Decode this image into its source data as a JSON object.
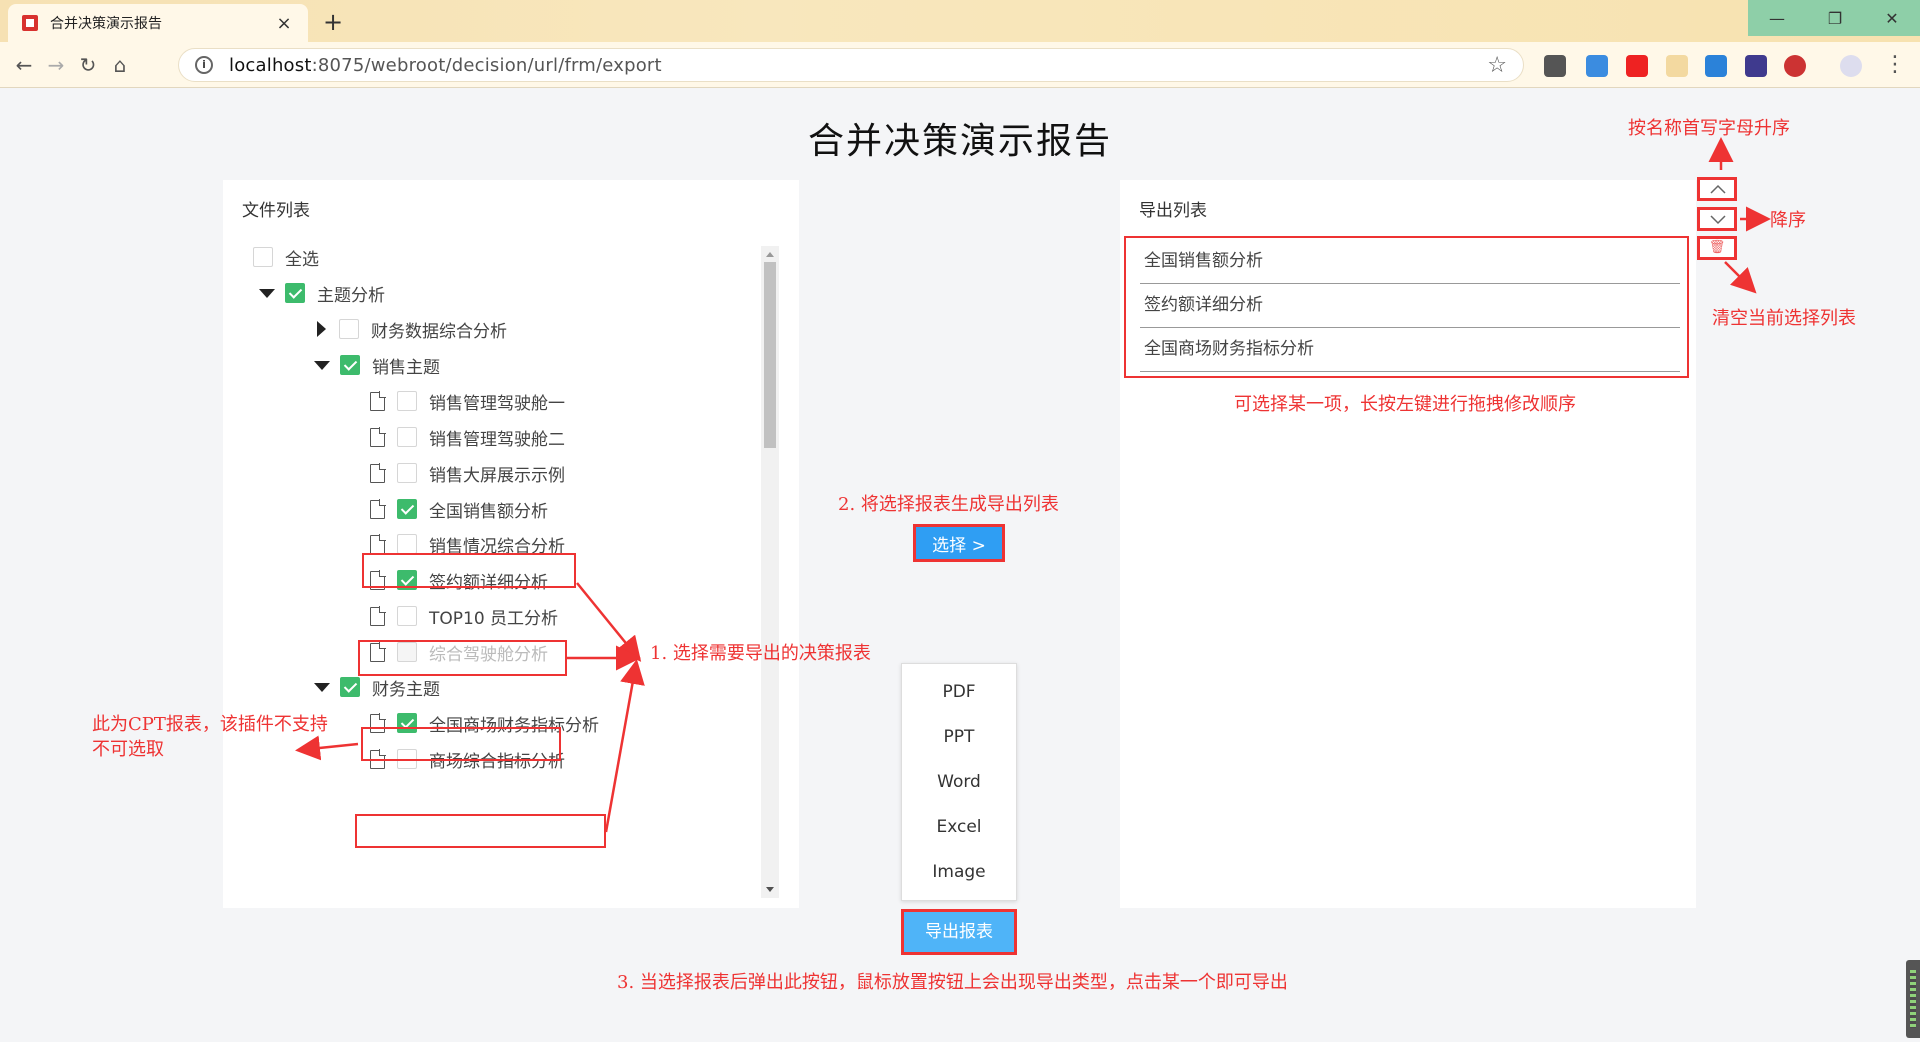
{
  "browser": {
    "tab_title": "合并决策演示报告",
    "tab_close": "×",
    "new_tab": "+",
    "url_host": "localhost",
    "url_rest": ":8075/webroot/decision/url/frm/export",
    "window_controls": {
      "minimize": "—",
      "maximize": "❐",
      "close": "✕"
    }
  },
  "page": {
    "title": "合并决策演示报告"
  },
  "file_panel": {
    "header": "文件列表",
    "select_all": "全选",
    "items": [
      {
        "label": "主题分析",
        "checked": true
      },
      {
        "label": "财务数据综合分析",
        "checked": false
      },
      {
        "label": "销售主题",
        "checked": true
      },
      {
        "label": "销售管理驾驶舱一",
        "checked": false
      },
      {
        "label": "销售管理驾驶舱二",
        "checked": false
      },
      {
        "label": "销售大屏展示示例",
        "checked": false
      },
      {
        "label": "全国销售额分析",
        "checked": true
      },
      {
        "label": "销售情况综合分析",
        "checked": false
      },
      {
        "label": "签约额详细分析",
        "checked": true
      },
      {
        "label": "TOP10 员工分析",
        "checked": false
      },
      {
        "label": "综合驾驶舱分析",
        "checked": false,
        "disabled": true
      },
      {
        "label": "财务主题",
        "checked": true
      },
      {
        "label": "全国商场财务指标分析",
        "checked": true
      },
      {
        "label": "商场综合指标分析",
        "checked": false
      }
    ]
  },
  "export_panel": {
    "header": "导出列表",
    "items": [
      "全国销售额分析",
      "签约额详细分析",
      "全国商场财务指标分析"
    ]
  },
  "actions": {
    "select_button": "选择 >",
    "export_button": "导出报表",
    "export_options": [
      "PDF",
      "PPT",
      "Word",
      "Excel",
      "Image"
    ],
    "trash_icon": "🗑"
  },
  "annotations": {
    "sort_asc": "按名称首写字母升序",
    "sort_desc": "降序",
    "clear_list": "清空当前选择列表",
    "drag_hint": "可选择某一项，长按左键进行拖拽修改顺序",
    "step2": "2.  将选择报表生成导出列表",
    "step1": "1. 选择需要导出的决策报表",
    "cpt_note_line1": "此为CPT报表，该插件不支持",
    "cpt_note_line2": "不可选取",
    "step3": "3. 当选择报表后弹出此按钮，鼠标放置按钮上会出现导出类型，点击某一个即可导出"
  },
  "colors": {
    "annotation_red": "#ee3333",
    "checkbox_green": "#3dbb6c",
    "button_blue": "#2f9ef3"
  }
}
